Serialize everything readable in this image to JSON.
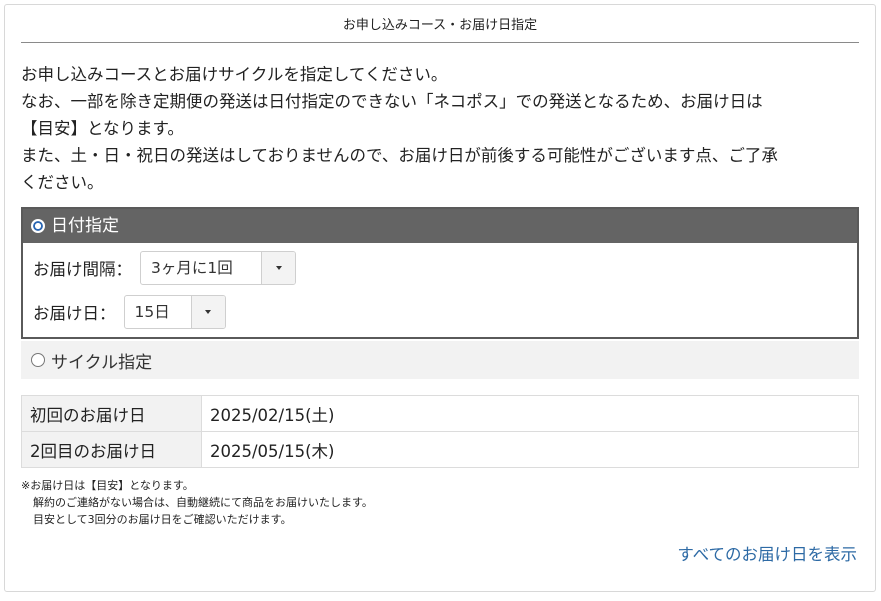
{
  "panel": {
    "title": "お申し込みコース・お届け日指定"
  },
  "intro": {
    "line1": "お申し込みコースとお届けサイクルを指定してください。",
    "line2": "なお、一部を除き定期便の発送は日付指定のできない「ネコポス」での発送となるため、お届け日は",
    "line3": "【目安】となります。",
    "line4": "また、土・日・祝日の発送はしておりませんので、お届け日が前後する可能性がございます点、ご了承",
    "line5": "ください。"
  },
  "option_date": {
    "label": "日付指定",
    "selected": true,
    "interval": {
      "label": "お届け間隔：",
      "value": "3ヶ月に1回"
    },
    "day": {
      "label": "お届け日：",
      "value": "15日"
    }
  },
  "option_cycle": {
    "label": "サイクル指定",
    "selected": false
  },
  "dates": [
    {
      "label": "初回のお届け日",
      "value": "2025/02/15(土)"
    },
    {
      "label": "2回目のお届け日",
      "value": "2025/05/15(木)"
    }
  ],
  "notes": {
    "line1": "※お届け日は【目安】となります。",
    "line2": "解約のご連絡がない場合は、自動継続にて商品をお届けいたします。",
    "line3": "目安として3回分のお届け日をご確認いただけます。"
  },
  "show_all_link": "すべてのお届け日を表示",
  "colors": {
    "option_header_bg": "#646464",
    "radio_selected": "#2a66b3",
    "link": "#2d6aa5",
    "label_cell_bg": "#f2f2f2"
  }
}
